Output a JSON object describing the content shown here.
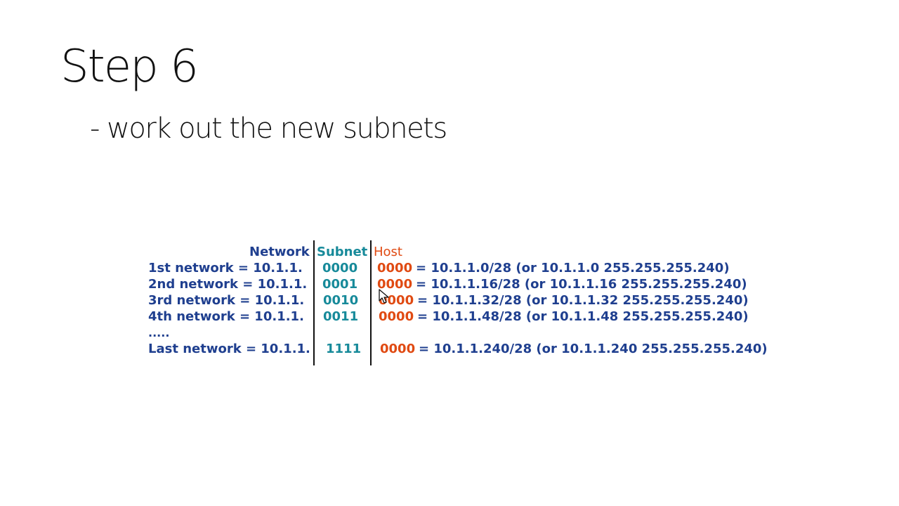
{
  "slide": {
    "title": "Step 6",
    "subtitle": "- work out the new subnets"
  },
  "table": {
    "headers": {
      "network": "Network",
      "subnet": "Subnet",
      "host": "Host"
    },
    "rows": [
      {
        "label": "1st network  = 10.1.1.",
        "subnet": "0000",
        "host": "0000",
        "rest": "= 10.1.1.0/28 (or 10.1.1.0 255.255.255.240)"
      },
      {
        "label": "2nd network = 10.1.1.",
        "subnet": "0001",
        "host": "0000",
        "rest": "= 10.1.1.16/28 (or 10.1.1.16 255.255.255.240)"
      },
      {
        "label": "3rd network  = 10.1.1.",
        "subnet": "0010",
        "host": "0000",
        "rest": "= 10.1.1.32/28 (or 10.1.1.32 255.255.255.240)"
      },
      {
        "label": "4th network  = 10.1.1.",
        "subnet": "0011",
        "host": "0000",
        "rest": "= 10.1.1.48/28 (or 10.1.1.48 255.255.255.240)"
      }
    ],
    "ellipsis": ".....",
    "last_row": {
      "label": "Last network = 10.1.1.",
      "subnet": "1111",
      "host": "0000",
      "rest": "= 10.1.1.240/28 (or 10.1.1.240 255.255.255.240)"
    }
  },
  "colors": {
    "network_blue": "#1f3f8f",
    "subnet_teal": "#178a9a",
    "host_orange": "#e04a12"
  },
  "cursor": {
    "icon": "mouse-pointer-icon"
  }
}
